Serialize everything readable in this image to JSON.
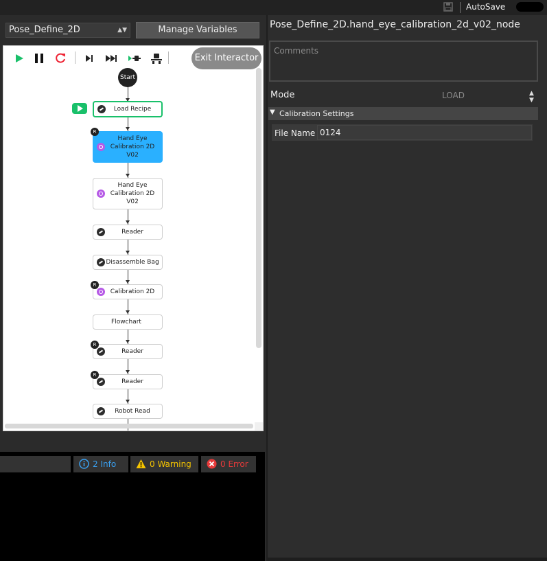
{
  "topbar": {
    "autosave_label": "AutoSave"
  },
  "toolbar": {
    "flow_select_value": "Pose_Define_2D",
    "manage_variables_label": "Manage Variables",
    "exit_interactor_label": "Exit Interactor"
  },
  "flowchart": {
    "start_label": "Start",
    "nodes": [
      {
        "label": "Load Recipe"
      },
      {
        "label": "Hand Eye Calibration 2D V02"
      },
      {
        "label": "Hand Eye Calibration 2D V02"
      },
      {
        "label": "Reader"
      },
      {
        "label": "Disassemble Bag"
      },
      {
        "label": "Calibration 2D"
      },
      {
        "label": "Flowchart"
      },
      {
        "label": "Reader"
      },
      {
        "label": "Reader"
      },
      {
        "label": "Robot Read"
      }
    ],
    "badge_r": "R"
  },
  "log": {
    "info_label": "2 Info",
    "warning_label": "0 Warning",
    "error_label": "0 Error"
  },
  "properties": {
    "node_title": "Pose_Define_2D.hand_eye_calibration_2d_v02_node",
    "comments_placeholder": "Comments",
    "mode_label": "Mode",
    "mode_value": "LOAD",
    "section_title": "Calibration Settings",
    "file_name_label": "File Name",
    "file_name_value": "0124"
  },
  "colors": {
    "selected_node": "#2ab0ff",
    "run_green": "#19c06a",
    "info": "#3aa0f0",
    "warning": "#f5c400",
    "error": "#e83a3a"
  }
}
